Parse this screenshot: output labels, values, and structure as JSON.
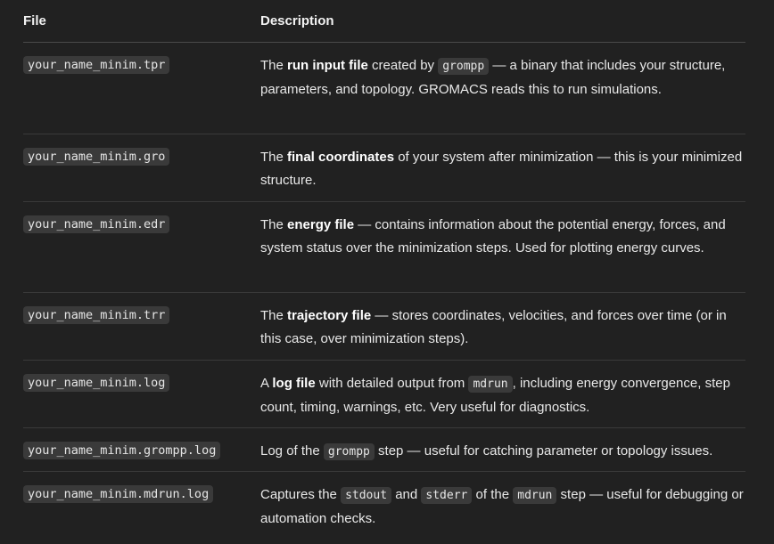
{
  "headers": {
    "file": "File",
    "description": "Description"
  },
  "rows": [
    {
      "file": "your_name_minim.tpr",
      "t1": "The ",
      "b1": "run input file",
      "t2": " created by ",
      "c1": "grompp",
      "t3": " — a binary that includes your structure, parameters, and topology. GROMACS reads this to run simulations."
    },
    {
      "file": "your_name_minim.gro",
      "t1": "The ",
      "b1": "final coordinates",
      "t2": " of your system after minimization — this is your minimized structure."
    },
    {
      "file": "your_name_minim.edr",
      "t1": "The ",
      "b1": "energy file",
      "t2": " — contains information about the potential energy, forces, and system status over the minimization steps. Used for plotting energy curves."
    },
    {
      "file": "your_name_minim.trr",
      "t1": "The ",
      "b1": "trajectory file",
      "t2": " — stores coordinates, velocities, and forces over time (or in this case, over minimization steps)."
    },
    {
      "file": "your_name_minim.log",
      "t1": "A ",
      "b1": "log file",
      "t2": " with detailed output from ",
      "c1": "mdrun",
      "t3": ", including energy convergence, step count, timing, warnings, etc. Very useful for diagnostics."
    },
    {
      "file": "your_name_minim.grompp.log",
      "t1": "Log of the ",
      "c1": "grompp",
      "t2": " step — useful for catching parameter or topology issues."
    },
    {
      "file": "your_name_minim.mdrun.log",
      "t1": "Captures the ",
      "c1": "stdout",
      "t2": " and ",
      "c2": "stderr",
      "t3": " of the ",
      "c3": "mdrun",
      "t4": " step — useful for debugging or automation checks."
    }
  ]
}
